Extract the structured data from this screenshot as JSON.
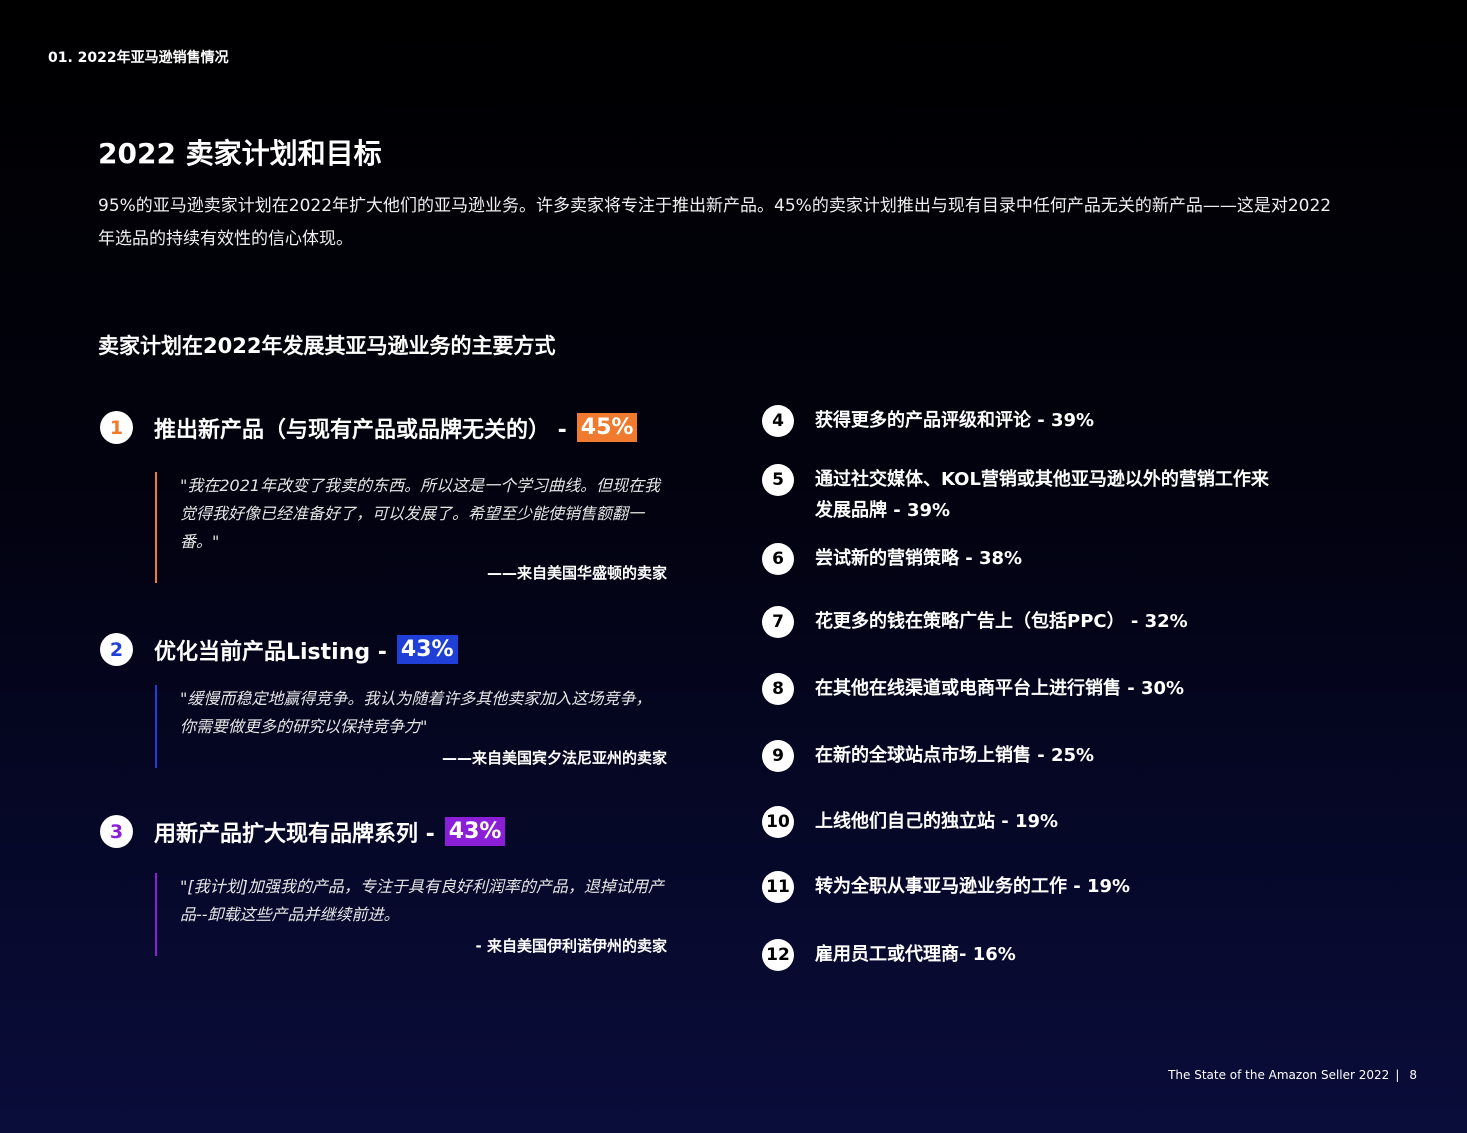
{
  "header": {
    "section": "01. 2022年亚马逊销售情况"
  },
  "title": "2022 卖家计划和目标",
  "intro": "95%的亚马逊卖家计划在2022年扩大他们的亚马逊业务。许多卖家将专注于推出新产品。45%的卖家计划推出与现有目录中任何产品无关的新产品——这是对2022年选品的持续有效性的信心体现。",
  "subheading": "卖家计划在2022年发展其亚马逊业务的主要方式",
  "colors": {
    "orange": "#f07a2d",
    "blue": "#1f3fd6",
    "purple": "#8b1fd8"
  },
  "main_items": [
    {
      "number": "1",
      "text": "推出新产品（与现有产品或品牌无关的） -",
      "percent": "45%",
      "quote": "\"我在2021年改变了我卖的东西。所以这是一个学习曲线。但现在我觉得我好像已经准备好了，可以发展了。希望至少能使销售额翻一番。\"",
      "source": "——来自美国华盛顿的卖家"
    },
    {
      "number": "2",
      "text": "优化当前产品Listing -",
      "percent": "43%",
      "quote": "\"缓慢而稳定地赢得竞争。我认为随着许多其他卖家加入这场竞争，你需要做更多的研究以保持竞争力\"",
      "source": "——来自美国宾夕法尼亚州的卖家"
    },
    {
      "number": "3",
      "text": "用新产品扩大现有品牌系列 -",
      "percent": "43%",
      "quote": "\"[我计划]加强我的产品，专注于具有良好利润率的产品，退掉试用产品--卸载这些产品并继续前进。",
      "source": "- 来自美国伊利诺伊州的卖家"
    }
  ],
  "ranked_items": [
    {
      "number": "4",
      "text": "获得更多的产品评级和评论 - 39%"
    },
    {
      "number": "5",
      "text": "通过社交媒体、KOL营销或其他亚马逊以外的营销工作来发展品牌 - 39%"
    },
    {
      "number": "6",
      "text": "尝试新的营销策略 - 38%"
    },
    {
      "number": "7",
      "text": "花更多的钱在策略广告上（包括PPC） - 32%"
    },
    {
      "number": "8",
      "text": "在其他在线渠道或电商平台上进行销售 - 30%"
    },
    {
      "number": "9",
      "text": "在新的全球站点市场上销售 - 25%"
    },
    {
      "number": "10",
      "text": "上线他们自己的独立站 - 19%"
    },
    {
      "number": "11",
      "text": "转为全职从事亚马逊业务的工作 - 19%"
    },
    {
      "number": "12",
      "text": "雇用员工或代理商- 16%"
    }
  ],
  "footer": {
    "report_title": "The State of the Amazon Seller 2022",
    "separator": "|",
    "page_number": "8"
  }
}
